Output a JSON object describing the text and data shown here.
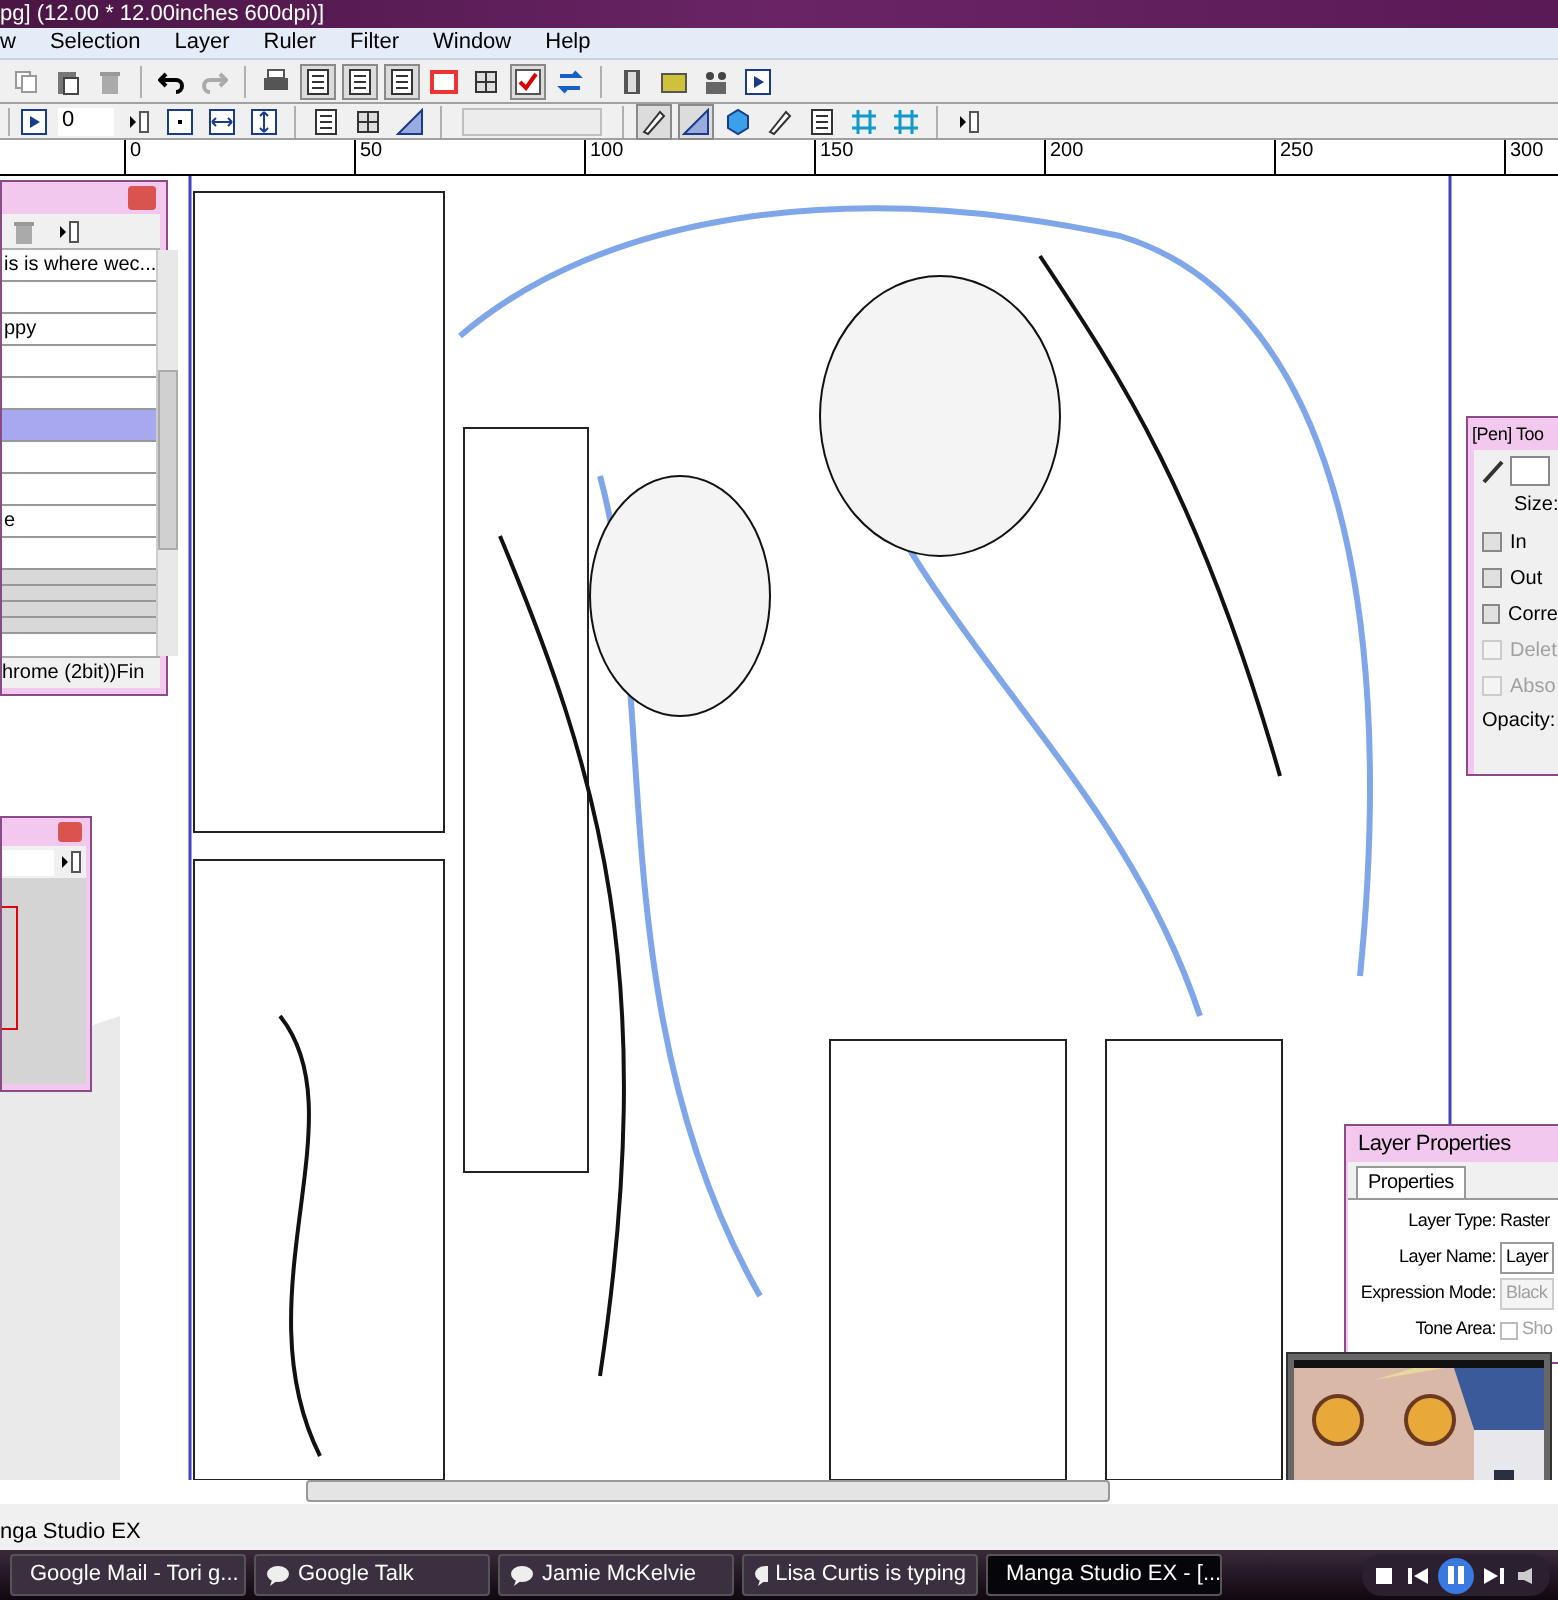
{
  "window": {
    "title": "pg] (12.00 * 12.00inches 600dpi)]"
  },
  "menu": [
    {
      "label": "w"
    },
    {
      "label": "Selection"
    },
    {
      "label": "Layer"
    },
    {
      "label": "Ruler"
    },
    {
      "label": "Filter"
    },
    {
      "label": "Window"
    },
    {
      "label": "Help"
    }
  ],
  "toolbar2": {
    "rotation_field": "0"
  },
  "ruler": [
    "0",
    "50",
    "100",
    "150",
    "200",
    "250",
    "300"
  ],
  "layers_panel": {
    "rows": [
      {
        "kind": "layer",
        "label": "is is where wec...",
        "selected": false
      },
      {
        "kind": "layer",
        "selected": false
      },
      {
        "kind": "layer",
        "label": "ppy",
        "selected": false
      },
      {
        "kind": "layer",
        "selected": false
      },
      {
        "kind": "layer",
        "selected": false
      },
      {
        "kind": "layer",
        "selected": true
      },
      {
        "kind": "layer",
        "selected": false
      },
      {
        "kind": "layer",
        "selected": false
      },
      {
        "kind": "layer",
        "label": "e",
        "selected": false
      },
      {
        "kind": "layer",
        "selected": false
      },
      {
        "kind": "blank",
        "selected": false
      },
      {
        "kind": "blank",
        "selected": false
      },
      {
        "kind": "blank",
        "selected": false
      },
      {
        "kind": "blank",
        "selected": false
      }
    ],
    "footer": "hrome (2bit))Fin"
  },
  "pen_panel": {
    "title": "[Pen] Too",
    "size_label": "Size:",
    "options": [
      {
        "label": "In",
        "checked": false,
        "disabled": false
      },
      {
        "label": "Out",
        "checked": false,
        "disabled": false
      },
      {
        "label": "Corre",
        "checked": false,
        "disabled": false
      },
      {
        "label": "Delet",
        "checked": false,
        "disabled": true
      },
      {
        "label": "Abso",
        "checked": false,
        "disabled": true
      }
    ],
    "opacity_label": "Opacity:"
  },
  "layer_properties": {
    "title": "Layer Properties",
    "tabs": [
      {
        "label": "Properties",
        "selected": true
      }
    ],
    "fields": [
      {
        "kind": "text",
        "label": "Layer Type:",
        "value": "Raster"
      },
      {
        "kind": "field",
        "label": "Layer Name:",
        "value": "Layer"
      },
      {
        "kind": "select",
        "label": "Expression Mode:",
        "value": "Black"
      },
      {
        "kind": "checkbox",
        "label": "Tone Area:",
        "value": "Sho",
        "checked": false
      }
    ]
  },
  "status_bar": "nga Studio EX",
  "taskbar": [
    {
      "kind": "browser",
      "label": "Google Mail - Tori g...",
      "selected": false
    },
    {
      "kind": "chat",
      "label": "Google Talk",
      "selected": false
    },
    {
      "kind": "chat",
      "label": "Jamie McKelvie",
      "selected": false
    },
    {
      "kind": "chat",
      "label": "Lisa Curtis is typing",
      "selected": false
    },
    {
      "kind": "app",
      "label": "Manga Studio EX - [...",
      "selected": true
    }
  ]
}
